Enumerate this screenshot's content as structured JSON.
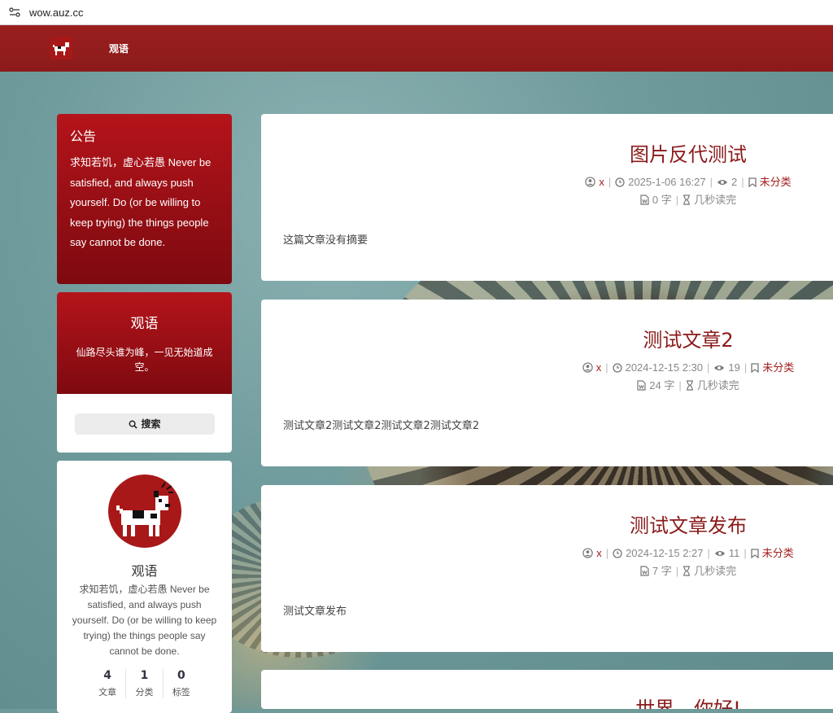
{
  "browser": {
    "url": "wow.auz.cc"
  },
  "header": {
    "site_title": "观语"
  },
  "notice": {
    "title": "公告",
    "body": "求知若饥，虚心若愚 Never be satisfied, and always push yourself. Do (or be willing to keep trying) the things people say cannot be done."
  },
  "motto": {
    "title": "观语",
    "text": "仙路尽头谁为峰，一见无始道成空。",
    "search_label": "搜索"
  },
  "profile": {
    "name": "观语",
    "bio": "求知若饥，虚心若愚 Never be satisfied, and always push yourself. Do (or be willing to keep trying) the things people say cannot be done.",
    "stats": [
      {
        "value": "4",
        "label": "文章"
      },
      {
        "value": "1",
        "label": "分类"
      },
      {
        "value": "0",
        "label": "标签"
      }
    ]
  },
  "posts": [
    {
      "title": "图片反代测试",
      "author": "x",
      "date": "2025-1-06 16:27",
      "views": "2",
      "category": "未分类",
      "words": "0 字",
      "read_time": "几秒读完",
      "excerpt": "这篇文章没有摘要"
    },
    {
      "title": "测试文章2",
      "author": "x",
      "date": "2024-12-15 2:30",
      "views": "19",
      "category": "未分类",
      "words": "24 字",
      "read_time": "几秒读完",
      "excerpt": "测试文章2测试文章2测试文章2测试文章2"
    },
    {
      "title": "测试文章发布",
      "author": "x",
      "date": "2024-12-15 2:27",
      "views": "11",
      "category": "未分类",
      "words": "7 字",
      "read_time": "几秒读完",
      "excerpt": "测试文章发布"
    },
    {
      "title": "世界，你好!"
    }
  ],
  "colors": {
    "brand": "#8c1a1a",
    "card_red_top": "#b4141a",
    "card_red_bottom": "#7d0a10"
  }
}
